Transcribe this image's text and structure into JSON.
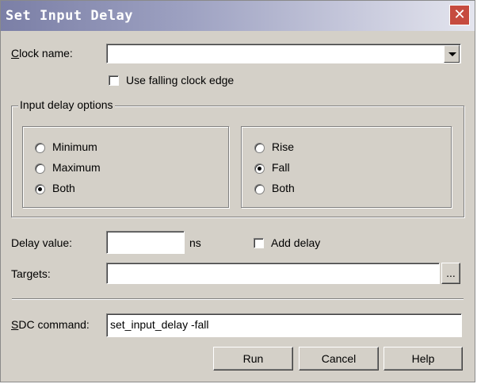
{
  "window": {
    "title": "Set Input Delay",
    "close_symbol": "✕"
  },
  "clock": {
    "label_key": "C",
    "label_rest": "lock name:",
    "value": "",
    "use_falling_edge_label": "Use falling clock edge",
    "use_falling_edge_checked": false
  },
  "input_delay_options": {
    "title": "Input delay options",
    "min_max_group": [
      {
        "label": "Minimum",
        "checked": false
      },
      {
        "label": "Maximum",
        "checked": false
      },
      {
        "label": "Both",
        "checked": true
      }
    ],
    "edge_group": [
      {
        "label": "Rise",
        "checked": false
      },
      {
        "label": "Fall",
        "checked": true
      },
      {
        "label": "Both",
        "checked": false
      }
    ]
  },
  "delay": {
    "label": "Delay value:",
    "value": "",
    "unit": "ns",
    "add_delay_label": "Add delay",
    "add_delay_checked": false
  },
  "targets": {
    "label": "Targets:",
    "value": "",
    "browse_label": "..."
  },
  "sdc": {
    "label_key": "S",
    "label_rest": "DC command:",
    "value": "set_input_delay -fall"
  },
  "buttons": {
    "run": "Run",
    "cancel": "Cancel",
    "help": "Help"
  }
}
